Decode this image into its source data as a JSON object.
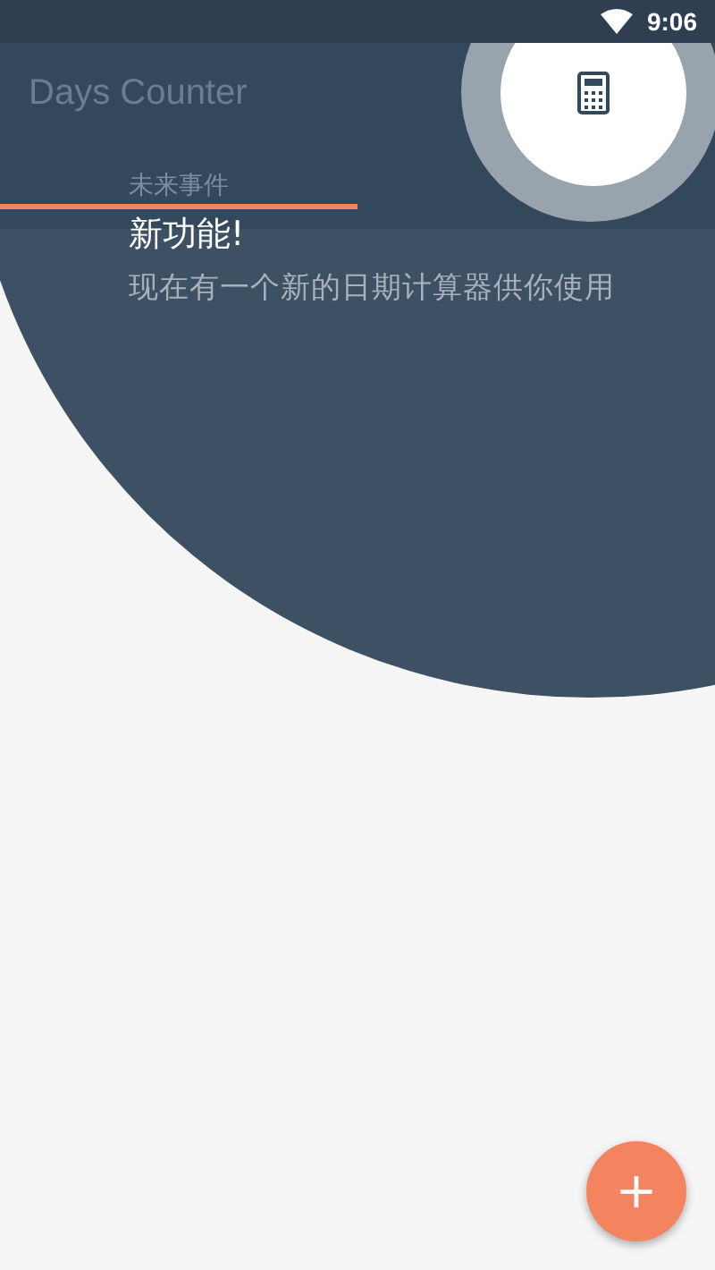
{
  "status_bar": {
    "time": "9:06"
  },
  "app_bar": {
    "title": "Days Counter"
  },
  "tabs": [
    {
      "label": "未来事件",
      "selected": true
    }
  ],
  "tutorial": {
    "title": "新功能!",
    "description": "现在有一个新的日期计算器供你使用"
  },
  "fab": {
    "label": "+"
  }
}
